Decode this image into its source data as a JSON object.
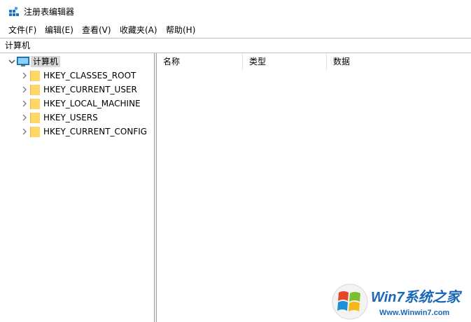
{
  "window": {
    "title": "注册表编辑器"
  },
  "menu": [
    "文件(F)",
    "编辑(E)",
    "查看(V)",
    "收藏夹(A)",
    "帮助(H)"
  ],
  "address": {
    "value": "计算机"
  },
  "tree": {
    "root": {
      "label": "计算机",
      "icon": "computer-icon",
      "expanded": true,
      "selected": true
    },
    "hives": [
      {
        "label": "HKEY_CLASSES_ROOT",
        "icon": "folder-icon"
      },
      {
        "label": "HKEY_CURRENT_USER",
        "icon": "folder-icon"
      },
      {
        "label": "HKEY_LOCAL_MACHINE",
        "icon": "folder-icon"
      },
      {
        "label": "HKEY_USERS",
        "icon": "folder-icon"
      },
      {
        "label": "HKEY_CURRENT_CONFIG",
        "icon": "folder-icon"
      }
    ]
  },
  "list": {
    "columns": [
      "名称",
      "类型",
      "数据"
    ]
  },
  "watermark": {
    "brand": "Win7系统之家",
    "url": "Www.Winwin7.com"
  },
  "colors": {
    "folder": "#ffd767",
    "monitor": "#1e90d6",
    "selection": "#d9d9d9",
    "brand_red": "#e8232b",
    "brand_blue": "#1a66b8"
  }
}
